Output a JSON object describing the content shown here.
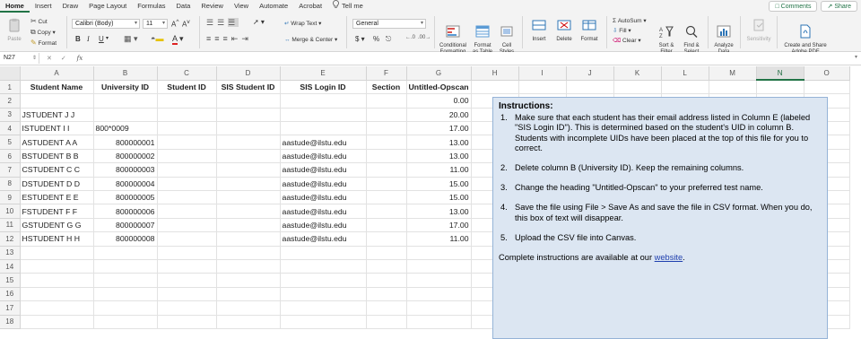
{
  "ribbon_tabs": [
    "Home",
    "Insert",
    "Draw",
    "Page Layout",
    "Formulas",
    "Data",
    "Review",
    "View",
    "Automate",
    "Acrobat"
  ],
  "tell_me": "Tell me",
  "comments_label": "Comments",
  "share_label": "Share",
  "clipboard": {
    "paste": "Paste",
    "cut": "Cut",
    "copy": "Copy",
    "format": "Format"
  },
  "font": {
    "name": "Calibri (Body)",
    "size": "11"
  },
  "alignment": {
    "wrap_text": "Wrap Text",
    "merge_center": "Merge & Center"
  },
  "number": {
    "format": "General",
    "currency": "$",
    "percent": "%"
  },
  "styles": {
    "conditional": "Conditional\nFormatting",
    "format_table": "Format\nas Table",
    "cell_styles": "Cell\nStyles"
  },
  "cells": {
    "insert": "Insert",
    "delete": "Delete",
    "format": "Format"
  },
  "editing": {
    "autosum": "AutoSum",
    "fill": "Fill",
    "clear": "Clear",
    "sort_filter": "Sort &\nFilter",
    "find_select": "Find &\nSelect"
  },
  "analyze": "Analyze\nData",
  "sensitivity": "Sensitivity",
  "create_pdf": "Create and Share\nAdobe PDF",
  "name_box": "N27",
  "fx_symbol": "fx",
  "columns": [
    "A",
    "B",
    "C",
    "D",
    "E",
    "F",
    "G",
    "H",
    "I",
    "J",
    "K",
    "L",
    "M",
    "N",
    "O"
  ],
  "selected_column": "N",
  "rows": [
    [
      "Student Name",
      "University ID",
      "Student ID",
      "SIS Student ID",
      "SIS Login ID",
      "Section",
      "Untitled-Opscan"
    ],
    [
      "",
      "",
      "",
      "",
      "",
      "",
      "0.00"
    ],
    [
      "JSTUDENT J J",
      "",
      "",
      "",
      "",
      "",
      "20.00"
    ],
    [
      "ISTUDENT I I",
      "800*0009",
      "",
      "",
      "",
      "",
      "17.00"
    ],
    [
      "ASTUDENT A A",
      "800000001",
      "",
      "",
      "aastude@ilstu.edu",
      "",
      "13.00"
    ],
    [
      "BSTUDENT B B",
      "800000002",
      "",
      "",
      "aastude@ilstu.edu",
      "",
      "13.00"
    ],
    [
      "CSTUDENT C C",
      "800000003",
      "",
      "",
      "aastude@ilstu.edu",
      "",
      "11.00"
    ],
    [
      "DSTUDENT D D",
      "800000004",
      "",
      "",
      "aastude@ilstu.edu",
      "",
      "15.00"
    ],
    [
      "ESTUDENT E E",
      "800000005",
      "",
      "",
      "aastude@ilstu.edu",
      "",
      "15.00"
    ],
    [
      "FSTUDENT F F",
      "800000006",
      "",
      "",
      "aastude@ilstu.edu",
      "",
      "13.00"
    ],
    [
      "GSTUDENT G G",
      "800000007",
      "",
      "",
      "aastude@ilstu.edu",
      "",
      "17.00"
    ],
    [
      "HSTUDENT H H",
      "800000008",
      "",
      "",
      "aastude@ilstu.edu",
      "",
      "11.00"
    ],
    [
      "",
      "",
      "",
      "",
      "",
      "",
      ""
    ],
    [
      "",
      "",
      "",
      "",
      "",
      "",
      ""
    ],
    [
      "",
      "",
      "",
      "",
      "",
      "",
      ""
    ],
    [
      "",
      "",
      "",
      "",
      "",
      "",
      ""
    ],
    [
      "",
      "",
      "",
      "",
      "",
      "",
      ""
    ],
    [
      "",
      "",
      "",
      "",
      "",
      "",
      ""
    ]
  ],
  "instructions": {
    "title": "Instructions:",
    "items": [
      "Make sure that each student has their email address listed in Column E (labeled \"SIS Login ID\"). This is determined based on the student's UID in column B. Students with incomplete UIDs have been placed at the top of this file for you to correct.",
      "Delete column B (University ID). Keep the remaining columns.",
      "Change the heading \"Untitled-Opscan\" to your preferred test name.",
      "Save the file using File > Save As and save the file in CSV format. When you do, this box of text will disappear.",
      "Upload the CSV file into Canvas."
    ],
    "footer_prefix": "Complete instructions are available at our ",
    "footer_link": "website",
    "footer_suffix": "."
  }
}
